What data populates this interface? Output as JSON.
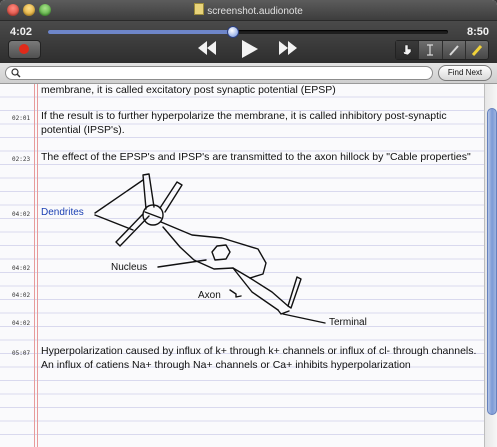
{
  "window": {
    "title": "screenshot.audionote",
    "buttons": {
      "close": "close-icon",
      "minimize": "minimize-icon",
      "zoom": "zoom-icon"
    }
  },
  "player": {
    "current_time": "4:02",
    "total_time": "8:50",
    "progress_fraction": 0.46,
    "record_color": "#e02a1a",
    "controls": [
      "rewind-icon",
      "play-icon",
      "fast-forward-icon"
    ],
    "tools": [
      "pointer-icon",
      "text-cursor-icon",
      "pencil-icon",
      "highlighter-icon"
    ]
  },
  "search": {
    "value": "",
    "placeholder": "",
    "find_next_label": "Find Next"
  },
  "notes": {
    "entries": [
      {
        "time": "",
        "text": "membrane, it is called excitatory post synaptic potential (EPSP)"
      },
      {
        "time": "02:01",
        "text": "If the result is to further hyperpolarize the membrane, it is called inhibitory post-synaptic potential (IPSP's)."
      },
      {
        "time": "02:23",
        "text": "The effect of the EPSP's and IPSP's are transmitted to the axon hillock by \"Cable properties\""
      },
      {
        "time": "04:02",
        "text": "Dendrites"
      },
      {
        "time": "04:02",
        "text": ""
      },
      {
        "time": "04:02",
        "text": ""
      },
      {
        "time": "04:02",
        "text": ""
      },
      {
        "time": "05:07",
        "text": "Hyperpolarization caused by influx of k+ through k+ channels or influx of cl- through channels. An influx of catiens Na+ through Na+ channels or Ca+ inhibits hyperpolarization"
      }
    ],
    "sketch_labels": {
      "nucleus": "Nucleus",
      "axon": "Axon",
      "terminal": "Terminal"
    },
    "link_color": "#1a3fb3"
  }
}
